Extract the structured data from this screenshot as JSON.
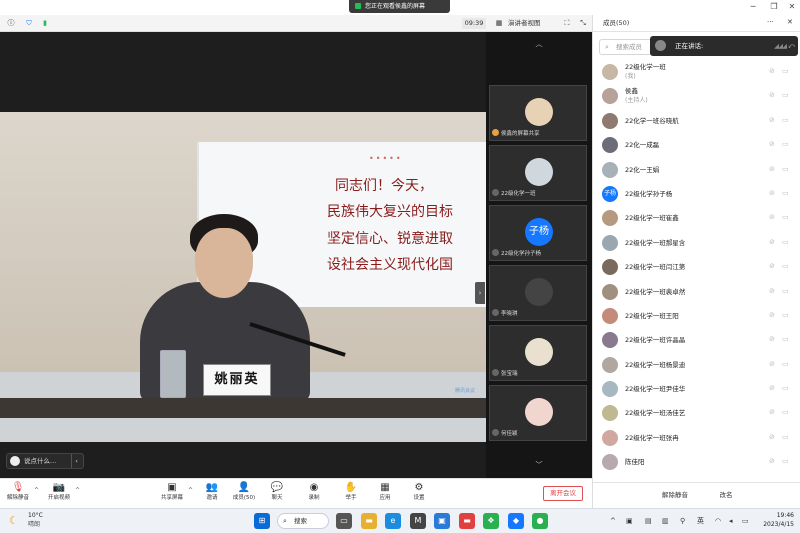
{
  "window": {
    "share_banner": "您正在观看侯鑫的屏幕",
    "clock": "09:39",
    "view_mode": "演讲者视图",
    "members_tab": "成员(50)"
  },
  "video": {
    "slide_lines": [
      "同志们！今天，",
      "民族伟大复兴的目标",
      "坚定信心、锐意进取",
      "设社会主义现代化国"
    ],
    "nameplate": "姚丽英",
    "say_placeholder": "说点什么...",
    "watermark": "腾讯会议"
  },
  "gallery": [
    {
      "label": "侯鑫的屏幕共享",
      "avatar": ""
    },
    {
      "label": "22级化学一班",
      "avatar": ""
    },
    {
      "label": "22级化学孙子杨",
      "avatar": "子杨",
      "color": "#1677ff"
    },
    {
      "label": "李晓琪",
      "avatar": ""
    },
    {
      "label": "张宝瑞",
      "avatar": ""
    },
    {
      "label": "何佳颖",
      "avatar": ""
    }
  ],
  "panel": {
    "search_placeholder": "搜索成员",
    "speaking_label": "正在讲话:",
    "participants": [
      {
        "name": "22级化学一班",
        "sub": "(我)",
        "avatar": ""
      },
      {
        "name": "侯鑫",
        "sub": "(主持人)",
        "avatar": ""
      },
      {
        "name": "22化学一班谷晓航",
        "sub": "",
        "avatar": ""
      },
      {
        "name": "22化一成磊",
        "sub": "",
        "avatar": ""
      },
      {
        "name": "22化一王娟",
        "sub": "",
        "avatar": ""
      },
      {
        "name": "22级化学孙子杨",
        "sub": "",
        "avatar": "子杨"
      },
      {
        "name": "22级化学一班崔鑫",
        "sub": "",
        "avatar": ""
      },
      {
        "name": "22级化学一班郝星含",
        "sub": "",
        "avatar": ""
      },
      {
        "name": "22级化学一班闫江第",
        "sub": "",
        "avatar": ""
      },
      {
        "name": "22级化学一班裴卓然",
        "sub": "",
        "avatar": ""
      },
      {
        "name": "22级化学一班王阳",
        "sub": "",
        "avatar": ""
      },
      {
        "name": "22级化学一班许晶晶",
        "sub": "",
        "avatar": ""
      },
      {
        "name": "22级化学一班杨景迪",
        "sub": "",
        "avatar": ""
      },
      {
        "name": "22级化学一班尹佳华",
        "sub": "",
        "avatar": ""
      },
      {
        "name": "22级化学一班汤佳艺",
        "sub": "",
        "avatar": ""
      },
      {
        "name": "22级化学一班张冉",
        "sub": "",
        "avatar": ""
      },
      {
        "name": "陈佳阳",
        "sub": "",
        "avatar": ""
      }
    ],
    "mute_all": "解除静音",
    "rename": "改名"
  },
  "toolbar": {
    "unmute": "解除静音",
    "start_video": "开启视频",
    "share_screen": "共享屏幕",
    "invite": "邀请",
    "members": "成员(50)",
    "chat": "聊天",
    "record": "录制",
    "raise_hand": "举手",
    "apps": "应用",
    "settings": "设置",
    "leave": "离开会议"
  },
  "taskbar": {
    "temp": "10°C",
    "weather": "晴朗",
    "search": "搜索",
    "ime": "英",
    "time": "19:46",
    "date": "2023/4/15"
  },
  "colors": {
    "accent": "#1677ff",
    "leave_red": "#e04040",
    "slide_text": "#8a1c1c"
  }
}
